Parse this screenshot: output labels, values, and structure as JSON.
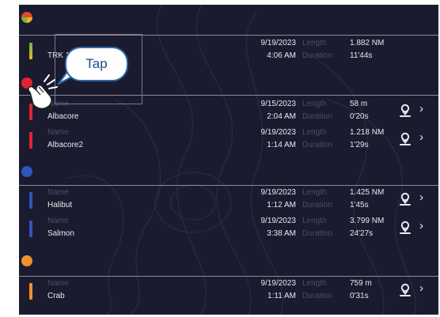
{
  "tap_hint": {
    "label": "Tap"
  },
  "groups": [
    {
      "color": "multicolor",
      "tracks": [
        {
          "name_label": "",
          "name": "TRK 1",
          "date": "9/19/2023",
          "time": "4:06 AM",
          "length_label": "Length",
          "length": "1.882 NM",
          "duration_label": "Duration",
          "duration": "11'44s",
          "show_pin": false
        }
      ]
    },
    {
      "color": "#e3232f",
      "tracks": [
        {
          "name_label": "Name",
          "name": "Albacore",
          "date": "9/15/2023",
          "time": "2:04 AM",
          "length_label": "Length",
          "length": "58 m",
          "duration_label": "Duration",
          "duration": "0'20s",
          "show_pin": true
        },
        {
          "name_label": "Name",
          "name": "Albacore2",
          "date": "9/19/2023",
          "time": "1:14 AM",
          "length_label": "Length",
          "length": "1.218 NM",
          "duration_label": "Duration",
          "duration": "1'29s",
          "show_pin": true
        }
      ]
    },
    {
      "color": "#2f55b8",
      "tracks": [
        {
          "name_label": "Name",
          "name": "Halibut",
          "date": "9/19/2023",
          "time": "1:12 AM",
          "length_label": "Length",
          "length": "1.425 NM",
          "duration_label": "Duration",
          "duration": "1'45s",
          "show_pin": true
        },
        {
          "name_label": "Name",
          "name": "Salmon",
          "date": "9/19/2023",
          "time": "3:38 AM",
          "length_label": "Length",
          "length": "3.799 NM",
          "duration_label": "Duration",
          "duration": "24'27s",
          "show_pin": true
        }
      ]
    },
    {
      "color": "#f0922b",
      "tracks": [
        {
          "name_label": "Name",
          "name": "Crab",
          "date": "9/19/2023",
          "time": "1:11 AM",
          "length_label": "Length",
          "length": "759 m",
          "duration_label": "Duration",
          "duration": "0'31s",
          "show_pin": true
        }
      ]
    }
  ]
}
